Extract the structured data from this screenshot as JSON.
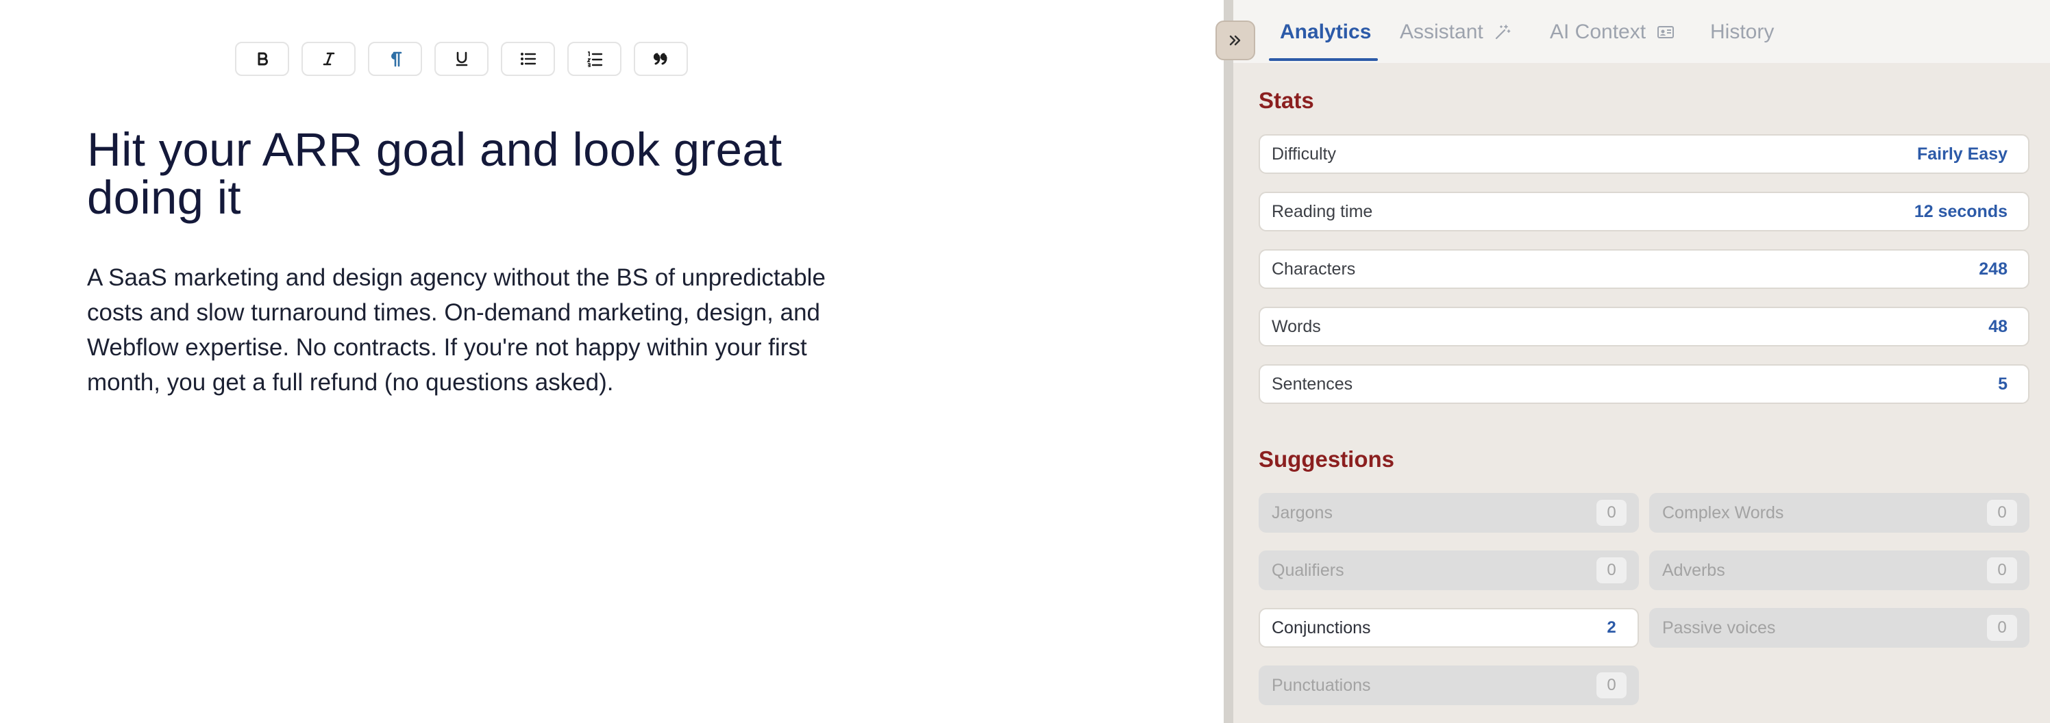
{
  "editor": {
    "toolbar": [
      {
        "name": "bold-button",
        "icon": "bold-icon",
        "active": false
      },
      {
        "name": "italic-button",
        "icon": "italic-icon",
        "active": false
      },
      {
        "name": "paragraph-button",
        "icon": "pilcrow-icon",
        "active": true
      },
      {
        "name": "underline-button",
        "icon": "underline-icon",
        "active": false
      },
      {
        "name": "bullet-list-button",
        "icon": "bullet-list-icon",
        "active": false
      },
      {
        "name": "numbered-list-button",
        "icon": "numbered-list-icon",
        "active": false
      },
      {
        "name": "blockquote-button",
        "icon": "quote-icon",
        "active": false
      }
    ],
    "title": "Hit your ARR goal and look great doing it",
    "body": "A SaaS marketing and design agency without the BS of unpredictable costs and slow turnaround times. On-demand marketing, design, and Webflow expertise. No contracts. If you're not happy within your first month, you get a full refund (no questions asked)."
  },
  "panel": {
    "collapse_icon": "double-chevron-right-icon",
    "tabs": [
      {
        "label": "Analytics",
        "active": true
      },
      {
        "label": "Assistant",
        "icon": "magic-wand-icon"
      },
      {
        "label": "AI Context",
        "icon": "id-card-icon"
      },
      {
        "label": "History"
      }
    ],
    "stats_title": "Stats",
    "stats": [
      {
        "label": "Difficulty",
        "value": "Fairly Easy"
      },
      {
        "label": "Reading time",
        "value": "12 seconds"
      },
      {
        "label": "Characters",
        "value": "248"
      },
      {
        "label": "Words",
        "value": "48"
      },
      {
        "label": "Sentences",
        "value": "5"
      }
    ],
    "suggestions_title": "Suggestions",
    "suggestions": [
      {
        "label": "Jargons",
        "count": "0"
      },
      {
        "label": "Complex Words",
        "count": "0"
      },
      {
        "label": "Qualifiers",
        "count": "0"
      },
      {
        "label": "Adverbs",
        "count": "0"
      },
      {
        "label": "Conjunctions",
        "count": "2"
      },
      {
        "label": "Passive voices",
        "count": "0"
      },
      {
        "label": "Punctuations",
        "count": "0"
      }
    ]
  },
  "colors": {
    "accent": "#2c5aa8",
    "section_title": "#8b1f1f",
    "panel_bg": "#ede9e4"
  }
}
